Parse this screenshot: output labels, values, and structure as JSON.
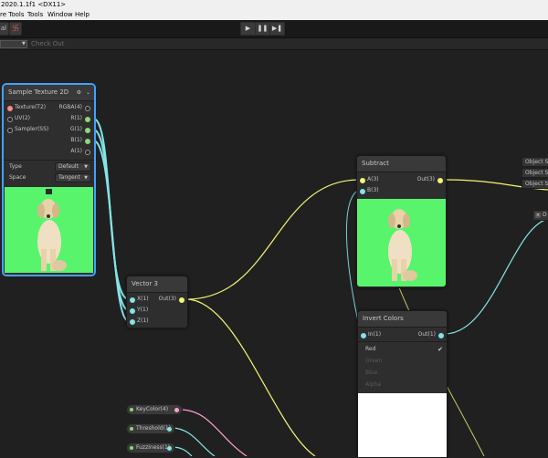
{
  "window": {
    "title": "2020.1.1f1 <DX11>"
  },
  "menu": [
    "re Tools",
    "Tools",
    "Window",
    "Help"
  ],
  "toolbar": {
    "left_label": "al",
    "collab_icon": "collab-icon"
  },
  "playback": {
    "play": "▶",
    "pause": "❚❚",
    "step": "▶❚"
  },
  "subbar": {
    "check_out": "Check Out"
  },
  "nodes": {
    "sample_texture": {
      "title": "Sample Texture 2D",
      "inputs": [
        "Texture(T2)",
        "UV(2)",
        "Sampler(SS)"
      ],
      "outputs": [
        "RGBA(4)",
        "R(1)",
        "G(1)",
        "B(1)",
        "A(1)"
      ],
      "type_label": "Type",
      "type_value": "Default",
      "space_label": "Space",
      "space_value": "Tangent"
    },
    "vector3": {
      "title": "Vector 3",
      "inputs": [
        "X(1)",
        "Y(1)",
        "Z(1)"
      ],
      "output": "Out(3)"
    },
    "subtract": {
      "title": "Subtract",
      "inputs": [
        "A(3)",
        "B(3)"
      ],
      "output": "Out(3)"
    },
    "invert": {
      "title": "Invert Colors",
      "input": "In(1)",
      "output": "Out(1)",
      "options": [
        {
          "label": "Red",
          "checked": true
        },
        {
          "label": "Green",
          "checked": false
        },
        {
          "label": "Blue",
          "checked": false
        },
        {
          "label": "Alpha",
          "checked": false
        }
      ]
    }
  },
  "properties": [
    "KeyColor(4)",
    "Threshold(1)",
    "Fuzziness(1)"
  ],
  "object_space": [
    "Object Sp",
    "Object Sp",
    "Object Sp"
  ],
  "side_button": "D",
  "colors": {
    "wire_blue": "#84e4e7",
    "wire_yellow": "#f5f576",
    "wire_pink": "#ff9fd4",
    "wire_green": "#8cd97a",
    "selection": "#44a0ff",
    "preview_green": "#58f56c"
  }
}
